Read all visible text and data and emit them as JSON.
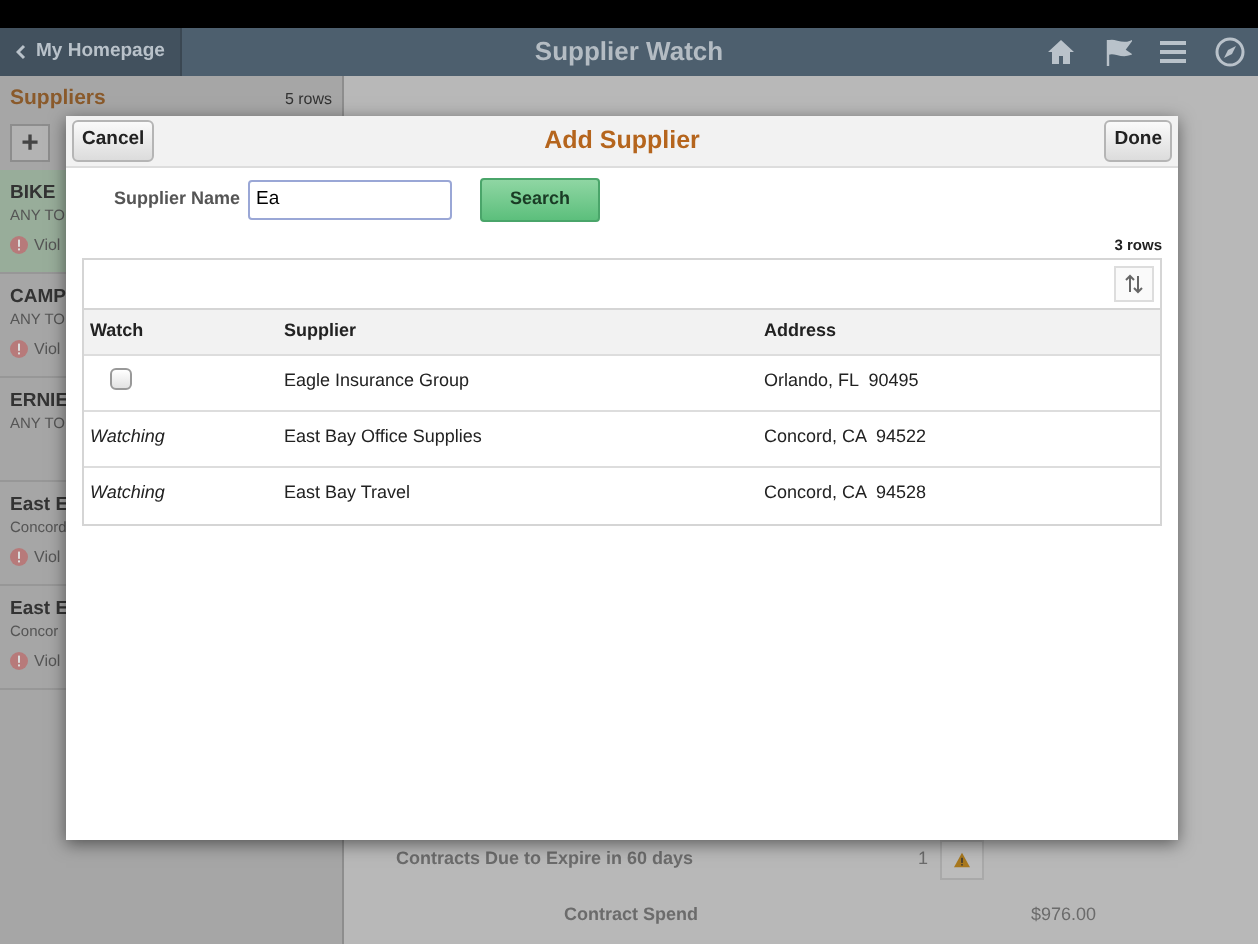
{
  "header": {
    "back_label": "My Homepage",
    "title": "Supplier Watch"
  },
  "sidebar": {
    "title": "Suppliers",
    "count": "5 rows",
    "add_label": "+",
    "items": [
      {
        "name": "BIKE",
        "location": "ANY TO",
        "alert": "Viol",
        "selected": true
      },
      {
        "name": "CAMP",
        "location": "ANY TO",
        "alert": "Viol",
        "selected": false
      },
      {
        "name": "ERNIE",
        "location": "ANY TO",
        "selected": false
      },
      {
        "name": "East E",
        "location": "Concord",
        "alert": "Viol",
        "selected": false
      },
      {
        "name": "East E",
        "location": "Concor",
        "alert": "Viol",
        "selected": false
      }
    ]
  },
  "summary": {
    "rows": [
      {
        "label": "Contracts Due to Expire in 60 days",
        "value": "1",
        "warning": true
      },
      {
        "label": "Contract Spend",
        "value": "$976.00"
      }
    ]
  },
  "dialog": {
    "title": "Add Supplier",
    "cancel_label": "Cancel",
    "done_label": "Done",
    "field_label": "Supplier Name",
    "field_value": "Ea",
    "search_label": "Search",
    "row_count": "3 rows",
    "columns": [
      "Watch",
      "Supplier",
      "Address"
    ],
    "rows": [
      {
        "watch": {
          "kind": "checkbox",
          "checked": false
        },
        "supplier": "Eagle Insurance Group",
        "address": "Orlando, FL  90495"
      },
      {
        "watch": {
          "kind": "status",
          "text": "Watching"
        },
        "supplier": "East Bay Office Supplies",
        "address": "Concord, CA  94522"
      },
      {
        "watch": {
          "kind": "status",
          "text": "Watching"
        },
        "supplier": "East Bay Travel",
        "address": "Concord, CA  94528"
      }
    ]
  }
}
